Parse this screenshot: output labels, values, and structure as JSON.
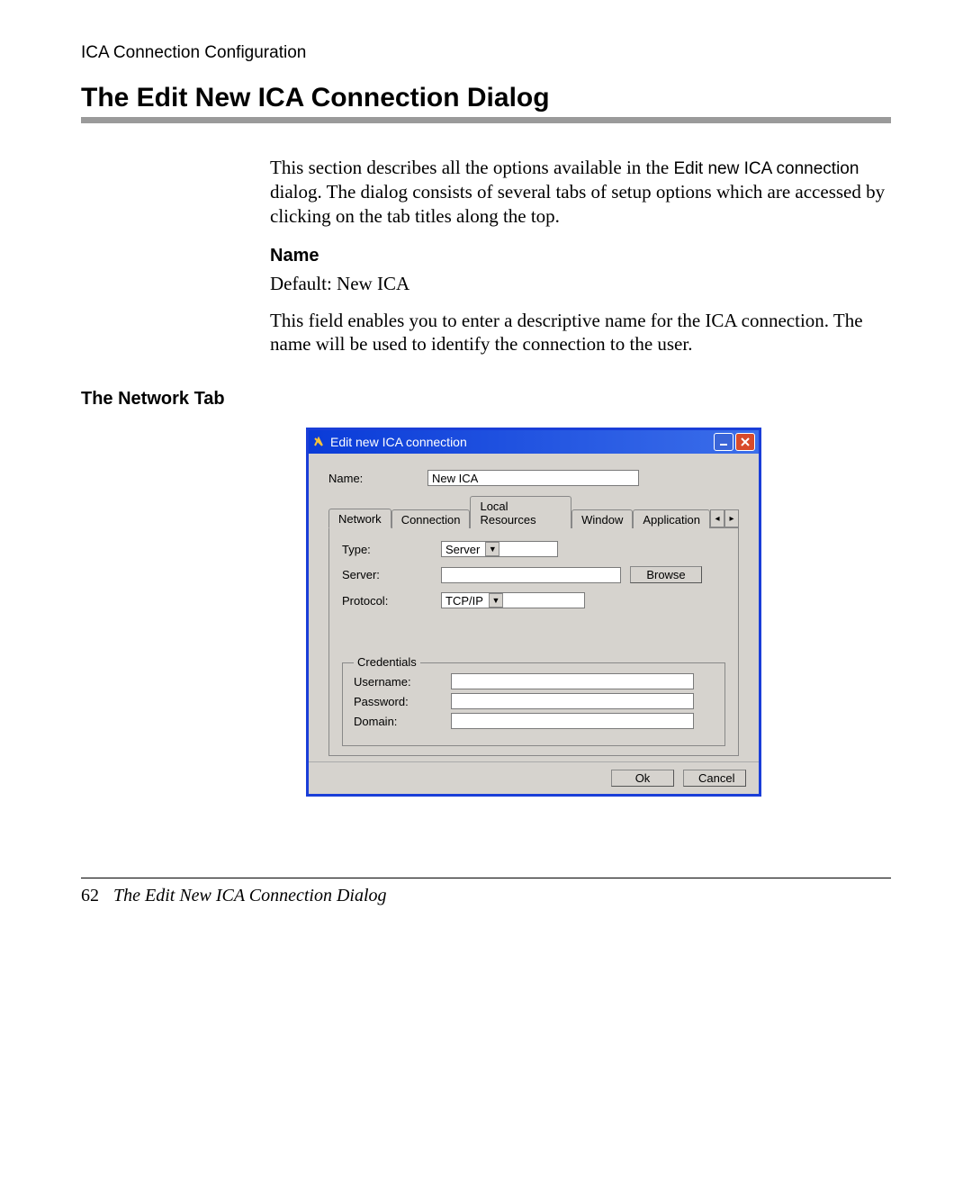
{
  "doc": {
    "running_header": "ICA Connection Configuration",
    "heading": "The Edit New ICA Connection Dialog",
    "intro_pre": "This section describes all the options available in the ",
    "intro_code": "Edit new ICA connection",
    "intro_post": " dialog. The dialog consists of several tabs of setup options which are accessed by clicking on the tab titles along the top.",
    "name_heading": "Name",
    "name_default": "Default: New ICA",
    "name_desc": "This field enables you to enter a descriptive name for the ICA connection. The name will be used to identify the connection to the user.",
    "network_tab_heading": "The Network Tab",
    "footer_page": "62",
    "footer_text": "The Edit New ICA Connection Dialog"
  },
  "dialog": {
    "title": "Edit new ICA connection",
    "name_label": "Name:",
    "name_value": "New ICA",
    "tabs": {
      "network": "Network",
      "connection": "Connection",
      "local_resources": "Local Resources",
      "window": "Window",
      "application": "Application"
    },
    "network": {
      "type_label": "Type:",
      "type_value": "Server",
      "server_label": "Server:",
      "server_value": "",
      "browse": "Browse",
      "protocol_label": "Protocol:",
      "protocol_value": "TCP/IP",
      "credentials_legend": "Credentials",
      "username_label": "Username:",
      "username_value": "",
      "password_label": "Password:",
      "password_value": "",
      "domain_label": "Domain:",
      "domain_value": ""
    },
    "buttons": {
      "ok": "Ok",
      "cancel": "Cancel"
    },
    "scroll_left": "◂",
    "scroll_right": "▸"
  }
}
